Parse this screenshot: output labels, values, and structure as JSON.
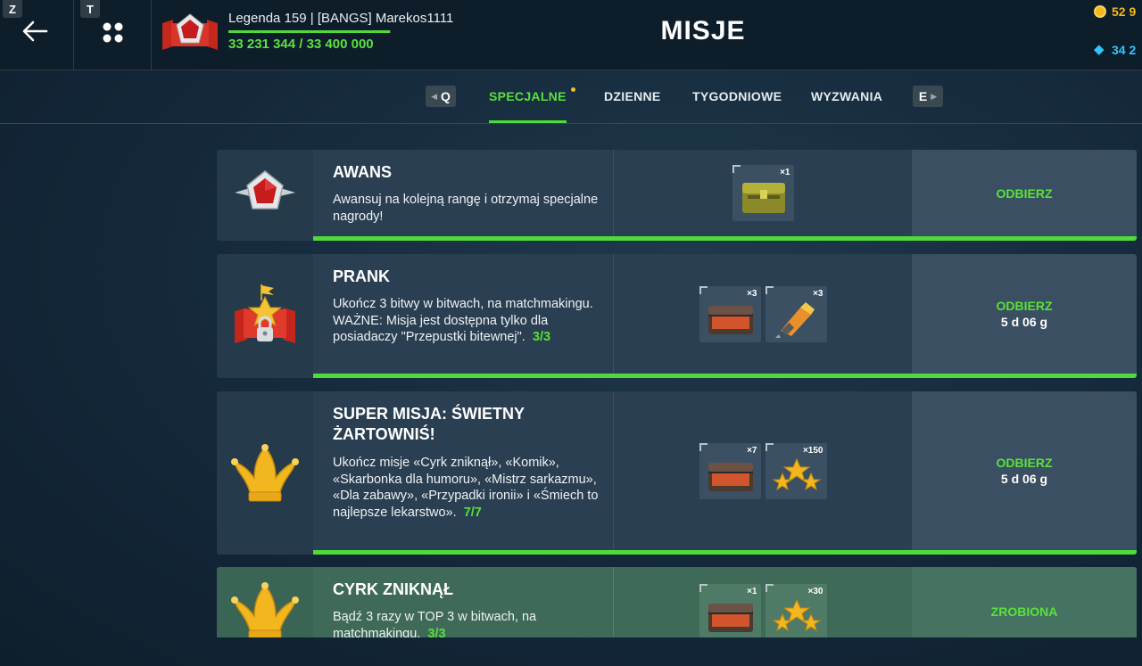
{
  "keys": {
    "back": "Z",
    "menu": "T",
    "tab_prev": "Q",
    "tab_next": "E"
  },
  "player": {
    "name": "Legenda 159 | [BANGS] Marekos1111",
    "xp_text": "33 231 344 / 33 400 000",
    "xp_progress": 0.995
  },
  "page_title": "MISJE",
  "currency": {
    "coins": "52 9",
    "gems": "34 2"
  },
  "tabs": [
    {
      "label": "SPECJALNE",
      "active": true,
      "has_notification": true
    },
    {
      "label": "DZIENNE",
      "active": false
    },
    {
      "label": "TYGODNIOWE",
      "active": false
    },
    {
      "label": "WYZWANIA",
      "active": false
    }
  ],
  "missions": [
    {
      "title": "AWANS",
      "description": "Awansuj na kolejną rangę i otrzymaj specjalne nagrody!",
      "progress_text": "",
      "icon": "rank-star-icon",
      "rewards": [
        {
          "qty": "×1",
          "icon": "green-crate-icon"
        }
      ],
      "action": "ODBIERZ",
      "timer": "",
      "state": "claimable",
      "progress": 1
    },
    {
      "title": "PRANK",
      "description": "Ukończ 3 bitwy w bitwach, na matchmakingu. WAŻNE: Misja jest dostępna tylko dla posiadaczy \"Przepustki bitewnej\".",
      "progress_text": "3/3",
      "icon": "battle-pass-locked-icon",
      "rewards": [
        {
          "qty": "×3",
          "icon": "red-chest-icon"
        },
        {
          "qty": "×3",
          "icon": "booster-icon"
        }
      ],
      "action": "ODBIERZ",
      "timer": "5 d 06 g",
      "state": "claimable",
      "progress": 1
    },
    {
      "title": "SUPER MISJA: ŚWIETNY ŻARTOWNIŚ!",
      "description": "Ukończ misje «Cyrk zniknął», «Komik», «Skarbonka dla humoru», «Mistrz sarkazmu», «Dla zabawy», «Przypadki ironii» i «Śmiech to najlepsze lekarstwo».",
      "progress_text": "7/7",
      "icon": "jester-hat-icon",
      "rewards": [
        {
          "qty": "×7",
          "icon": "red-chest-icon"
        },
        {
          "qty": "×150",
          "icon": "stars-icon"
        }
      ],
      "action": "ODBIERZ",
      "timer": "5 d 06 g",
      "state": "claimable",
      "progress": 1
    },
    {
      "title": "CYRK ZNIKNĄŁ",
      "description": "Bądź 3 razy w TOP 3 w bitwach, na matchmakingu.",
      "progress_text": "3/3",
      "icon": "jester-hat-icon",
      "rewards": [
        {
          "qty": "×1",
          "icon": "red-chest-icon"
        },
        {
          "qty": "×30",
          "icon": "stars-icon"
        }
      ],
      "action": "ZROBIONA",
      "timer": "",
      "state": "done",
      "progress": 1
    }
  ],
  "colors": {
    "accent_green": "#4fdc3a",
    "card_bg": "#2a3f51",
    "card_done_bg": "#3f6a58",
    "header_bg": "#0e1d2a",
    "coin": "#f4b81e",
    "gem": "#2fc6ff"
  }
}
